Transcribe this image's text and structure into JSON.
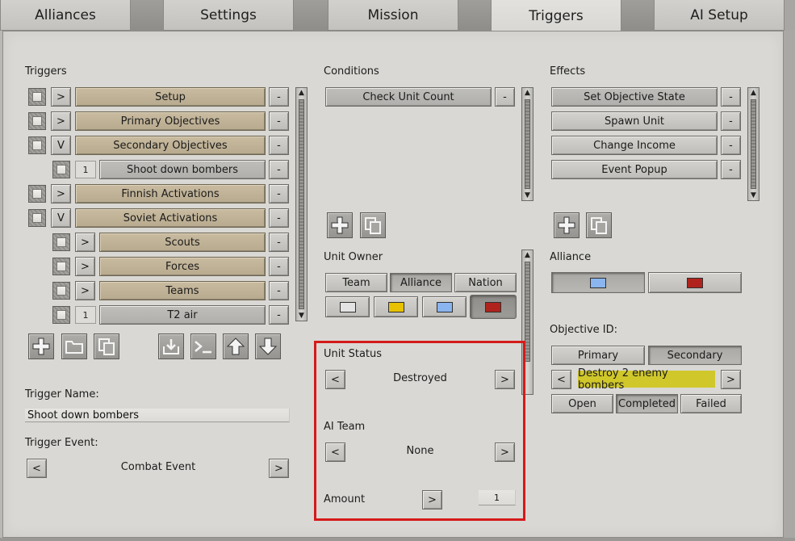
{
  "tabs": [
    {
      "label": "Alliances"
    },
    {
      "label": "Settings"
    },
    {
      "label": "Mission"
    },
    {
      "label": "Triggers"
    },
    {
      "label": "AI Setup"
    }
  ],
  "triggers": {
    "heading": "Triggers",
    "items": [
      {
        "toggle": ">",
        "label": "Setup",
        "remove": "-"
      },
      {
        "toggle": ">",
        "label": "Primary Objectives",
        "remove": "-"
      },
      {
        "toggle": "V",
        "label": "Secondary Objectives",
        "remove": "-"
      },
      {
        "toggle": "1",
        "label": "Shoot down bombers",
        "remove": "-"
      },
      {
        "toggle": ">",
        "label": "Finnish Activations",
        "remove": "-"
      },
      {
        "toggle": "V",
        "label": "Soviet Activations",
        "remove": "-"
      },
      {
        "toggle": ">",
        "label": "Scouts",
        "remove": "-"
      },
      {
        "toggle": ">",
        "label": "Forces",
        "remove": "-"
      },
      {
        "toggle": ">",
        "label": "Teams",
        "remove": "-"
      },
      {
        "toggle": "1",
        "label": "T2 air",
        "remove": "-"
      }
    ],
    "name_label": "Trigger Name:",
    "name_value": "Shoot down bombers",
    "event_label": "Trigger Event:",
    "event_value": "Combat Event",
    "prev": "<",
    "next": ">"
  },
  "conditions": {
    "heading": "Conditions",
    "items": [
      {
        "label": "Check Unit Count",
        "remove": "-"
      }
    ],
    "unit_owner_label": "Unit Owner",
    "owner_options": [
      "Team",
      "Alliance",
      "Nation"
    ],
    "owner_selected": "Alliance",
    "team_colors": [
      "#e3e3e3",
      "#e8c100",
      "#8ab5ef",
      "#b0231c"
    ],
    "unit_status_label": "Unit Status",
    "unit_status_value": "Destroyed",
    "ai_team_label": "AI Team",
    "ai_team_value": "None",
    "amount_label": "Amount",
    "amount_value": "1",
    "prev": "<",
    "next": ">"
  },
  "effects": {
    "heading": "Effects",
    "items": [
      {
        "label": "Set Objective State",
        "remove": "-"
      },
      {
        "label": "Spawn Unit",
        "remove": "-"
      },
      {
        "label": "Change Income",
        "remove": "-"
      },
      {
        "label": "Event Popup",
        "remove": "-"
      }
    ],
    "alliance_label": "Alliance",
    "alliance_colors": [
      "#8ab5ef",
      "#b0231c"
    ],
    "objective_label": "Objective ID:",
    "objective_types": [
      "Primary",
      "Secondary"
    ],
    "objective_type_selected": "Secondary",
    "objective_value": "Destroy 2 enemy bombers",
    "states": [
      "Open",
      "Completed",
      "Failed"
    ],
    "state_selected": "Completed",
    "prev": "<",
    "next": ">"
  },
  "colors": {
    "highlight": "#d51a1a",
    "accent_tan": "#c9bba0",
    "objective_yellow": "#d0c72a"
  }
}
